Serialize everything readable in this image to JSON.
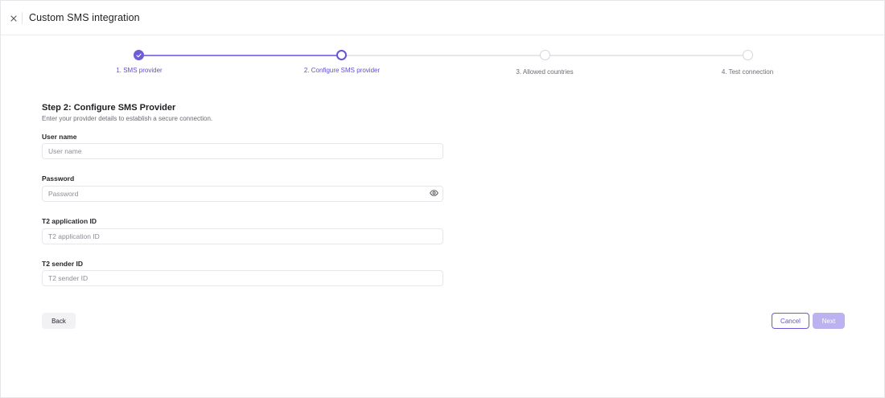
{
  "header": {
    "title": "Custom SMS integration",
    "close_icon": "close-icon"
  },
  "stepper": {
    "steps": [
      {
        "label": "1. SMS provider",
        "state": "completed"
      },
      {
        "label": "2. Configure SMS provider",
        "state": "active"
      },
      {
        "label": "3. Allowed countries",
        "state": "upcoming"
      },
      {
        "label": "4. Test connection",
        "state": "upcoming"
      }
    ]
  },
  "form": {
    "title": "Step 2: Configure SMS Provider",
    "subtitle": "Enter your provider details to establish a secure connection.",
    "fields": [
      {
        "label": "User name",
        "placeholder": "User name",
        "value": ""
      },
      {
        "label": "Password",
        "placeholder": "Password",
        "value": "",
        "icon": "eye-icon"
      },
      {
        "label": "T2 application ID",
        "placeholder": "T2 application ID",
        "value": ""
      },
      {
        "label": "T2 sender ID",
        "placeholder": "T2 sender ID",
        "value": ""
      }
    ]
  },
  "actions": {
    "back_label": "Back",
    "cancel_label": "Cancel",
    "next_label": "Next"
  },
  "colors": {
    "accent": "#6d5ed8",
    "accent_light": "#bdb2f0",
    "border": "#e7e7eb"
  }
}
